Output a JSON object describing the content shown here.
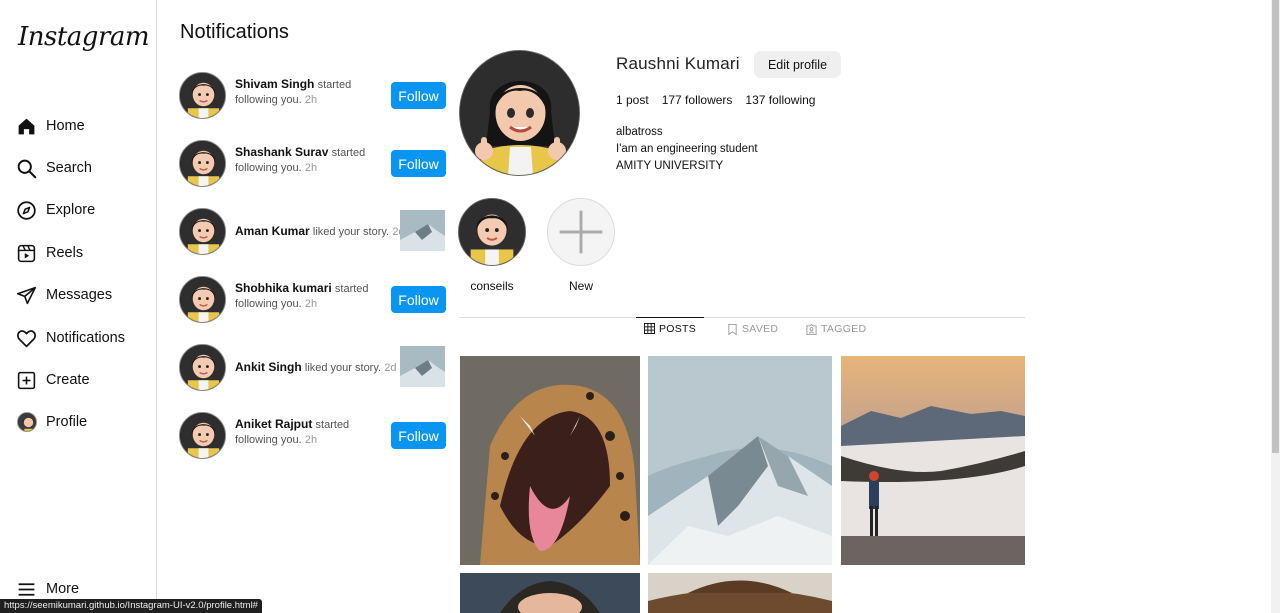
{
  "app": {
    "logo_text": "Instagram"
  },
  "sidebar": {
    "items": [
      {
        "label": "Home",
        "icon": "home-icon"
      },
      {
        "label": "Search",
        "icon": "search-icon"
      },
      {
        "label": "Explore",
        "icon": "compass-icon"
      },
      {
        "label": "Reels",
        "icon": "reels-icon"
      },
      {
        "label": "Messages",
        "icon": "send-icon"
      },
      {
        "label": "Notifications",
        "icon": "heart-icon"
      },
      {
        "label": "Create",
        "icon": "plus-square-icon"
      },
      {
        "label": "Profile",
        "icon": "avatar"
      }
    ],
    "more_label": "More"
  },
  "notifications": {
    "title": "Notifications",
    "follow_label": "Follow",
    "items": [
      {
        "user": "Shivam Singh",
        "action": "started following you.",
        "time": "2h",
        "type": "follow"
      },
      {
        "user": "Shashank Surav",
        "action": "started following you.",
        "time": "2h",
        "type": "follow"
      },
      {
        "user": "Aman Kumar",
        "action": "liked your story.",
        "time": "2d",
        "type": "like"
      },
      {
        "user": "Shobhika kumari",
        "action": "started following you.",
        "time": "2h",
        "type": "follow"
      },
      {
        "user": "Ankit Singh",
        "action": "liked your story.",
        "time": "2d",
        "type": "like"
      },
      {
        "user": "Aniket Rajput",
        "action": "started following you.",
        "time": "2h",
        "type": "follow"
      }
    ]
  },
  "profile": {
    "name": "Raushni Kumari",
    "edit_label": "Edit profile",
    "stats": {
      "posts": "1 post",
      "followers": "177 followers",
      "following": "137 following"
    },
    "bio": [
      "albatross",
      "I'am an engineering student",
      "AMITY UNIVERSITY"
    ],
    "highlights": [
      {
        "label": "conseils"
      },
      {
        "label": "New"
      }
    ],
    "tabs": [
      {
        "label": "POSTS",
        "icon": "grid-icon",
        "active": true
      },
      {
        "label": "SAVED",
        "icon": "bookmark-icon",
        "active": false
      },
      {
        "label": "TAGGED",
        "icon": "tag-person-icon",
        "active": false
      }
    ]
  },
  "status_bar": {
    "url": "https://seemikumari.github.io/Instagram-UI-v2.0/profile.html#"
  },
  "colors": {
    "accent": "#0a95f0",
    "button_gray": "#efefef",
    "border": "#dbdbdb"
  }
}
